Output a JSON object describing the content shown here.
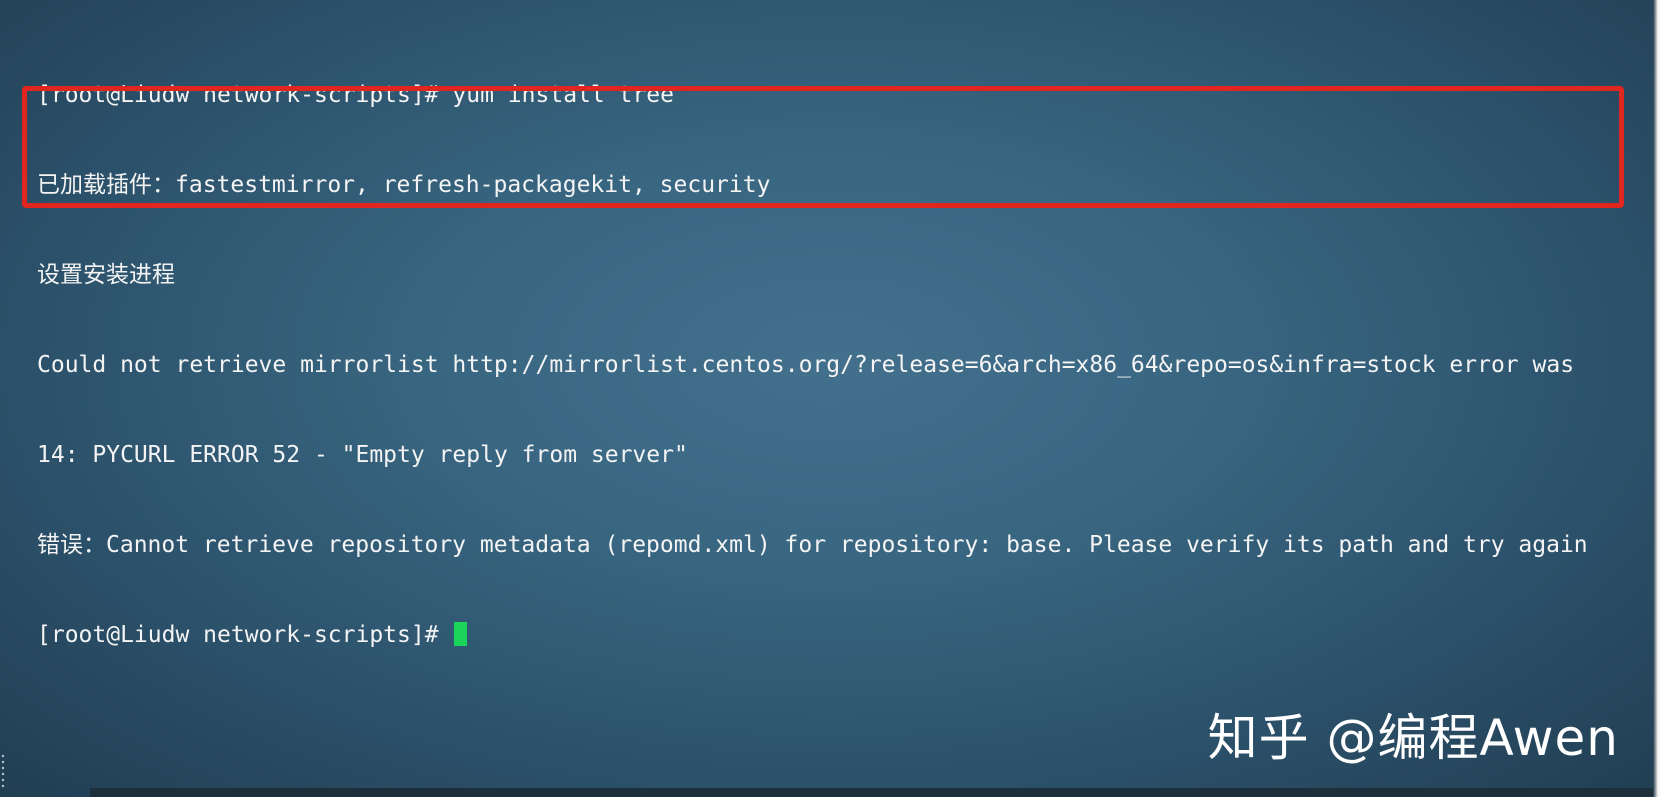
{
  "terminal": {
    "background_color": "#386580",
    "text_color": "#f4f4f4",
    "cursor_color": "#1bd45a",
    "lines": [
      "[root@Liudw network-scripts]# yum install tree",
      "已加载插件：fastestmirror, refresh-packagekit, security",
      "设置安装进程",
      "Could not retrieve mirrorlist http://mirrorlist.centos.org/?release=6&arch=x86_64&repo=os&infra=stock error was",
      "14: PYCURL ERROR 52 - \"Empty reply from server\"",
      "错误：Cannot retrieve repository metadata (repomd.xml) for repository: base. Please verify its path and try again"
    ],
    "prompt": "[root@Liudw network-scripts]# "
  },
  "annotation": {
    "highlight_color": "#e0261e"
  },
  "watermark": {
    "text": "知乎 @编程Awen"
  }
}
